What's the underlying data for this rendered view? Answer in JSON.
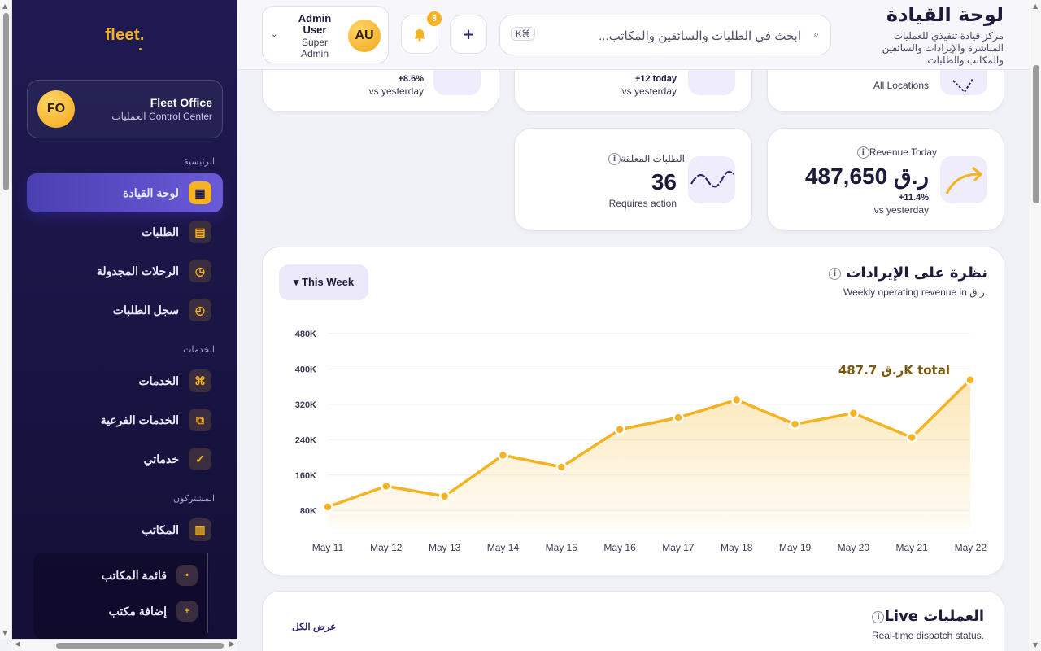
{
  "sidebar": {
    "logo": "fleet.",
    "office": {
      "initials": "FO",
      "name": "Fleet Office",
      "subtitle": "العمليات Control Center"
    },
    "sections": {
      "main": "الرئيسية",
      "services": "الخدمات",
      "subscribers": "المشتركون"
    },
    "items": [
      {
        "label": "لوحة القيادة",
        "icon": "dashboard-grid-icon",
        "glyph": "▦",
        "active": true
      },
      {
        "label": "الطلبات",
        "icon": "orders-list-icon",
        "glyph": "▤"
      },
      {
        "label": "الرحلات المجدولة",
        "icon": "clock-icon",
        "glyph": "◷"
      },
      {
        "label": "سجل الطلبات",
        "icon": "history-icon",
        "glyph": "◴"
      },
      {
        "label": "الخدمات",
        "icon": "command-icon",
        "glyph": "⌘"
      },
      {
        "label": "الخدمات الفرعية",
        "icon": "layers-icon",
        "glyph": "⧉"
      },
      {
        "label": "خدماتي",
        "icon": "check-icon",
        "glyph": "✓"
      },
      {
        "label": "المكاتب",
        "icon": "building-icon",
        "glyph": "▥"
      }
    ],
    "sub_items": [
      {
        "label": "قائمة المكاتب",
        "icon": "dot-icon",
        "glyph": "•"
      },
      {
        "label": "إضافة مكتب",
        "icon": "plus-icon",
        "glyph": "+"
      }
    ]
  },
  "header": {
    "title": "لوحة القيادة",
    "description": "مركز قيادة تنفيذي للعمليات المباشرة والإيرادات والسائقين والمكاتب والطلبات.",
    "search_placeholder": "ابحث في الطلبات والسائقين والمكاتب...",
    "search_shortcut": "K⌘",
    "add_label": "+",
    "notification_count": "8",
    "user": {
      "initials": "AU",
      "name": "Admin User",
      "role": "Super Admin"
    }
  },
  "kpis_top": [
    {
      "trend": "+8.6%",
      "sub": "vs yesterday"
    },
    {
      "trend": "+12 today",
      "sub": "vs yesterday"
    },
    {
      "sub": "All Locations"
    }
  ],
  "kpis": [
    {
      "label": "Revenue Today",
      "value": "ر.ق 487,650",
      "trend": "+11.4%",
      "sub": "vs yesterday"
    },
    {
      "label": "الطلبات المعلقة",
      "value": "36",
      "sub": "Requires action"
    }
  ],
  "revenue_chart": {
    "title": "نظرة على الإيرادات",
    "subtitle": "Weekly operating revenue in ر.ق.",
    "range_button": "▾ This Week",
    "total_label": "487.7 ر.قK total"
  },
  "chart_data": {
    "type": "area",
    "categories": [
      "May 11",
      "May 12",
      "May 13",
      "May 14",
      "May 15",
      "May 16",
      "May 17",
      "May 18",
      "May 19",
      "May 20",
      "May 21",
      "May 22"
    ],
    "values": [
      88000,
      135000,
      112000,
      205000,
      178000,
      263000,
      290000,
      330000,
      275000,
      300000,
      245000,
      375000
    ],
    "yticks": [
      "80K",
      "160K",
      "240K",
      "320K",
      "400K",
      "480K"
    ],
    "ylim": [
      40000,
      500000
    ],
    "grid": true,
    "color": "#f5b321",
    "title": "",
    "xlabel": "",
    "ylabel": ""
  },
  "live_ops": {
    "title": "Live العمليات",
    "subtitle": "Real-time dispatch status.",
    "view_all": "عرض الكل"
  }
}
